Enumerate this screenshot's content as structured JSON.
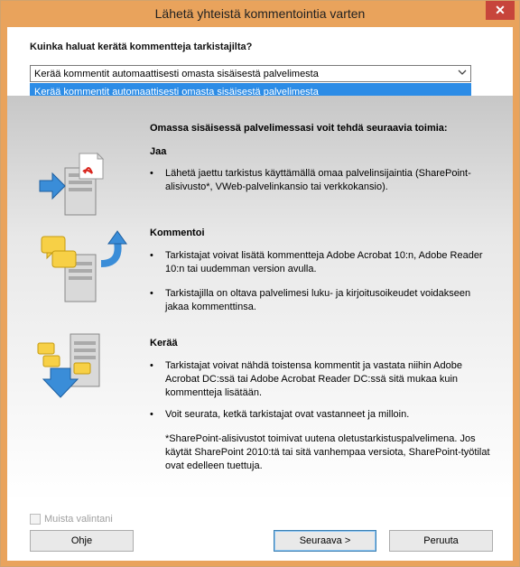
{
  "window": {
    "title": "Lähetä yhteistä kommentointia varten",
    "close_symbol": "✕"
  },
  "top": {
    "question": "Kuinka haluat kerätä kommentteja tarkistajilta?",
    "select_value": "Kerää kommentit automaattisesti omasta sisäisestä palvelimesta",
    "dropdown_options": [
      "Kerää kommentit automaattisesti omasta sisäisestä palvelimesta"
    ]
  },
  "main": {
    "intro": "Omassa sisäisessä palvelimessasi voit tehdä seuraavia toimia:",
    "sections": [
      {
        "title": "Jaa",
        "icon": "share-server-icon",
        "bullets": [
          "Lähetä jaettu tarkistus käyttämällä omaa palvelinsijaintia (SharePoint-alisivusto*, VWeb-palvelinkansio tai verkkokansio)."
        ]
      },
      {
        "title": "Kommentoi",
        "icon": "comment-server-icon",
        "bullets": [
          "Tarkistajat voivat lisätä kommentteja Adobe Acrobat 10:n, Adobe Reader 10:n tai uudemman version avulla.",
          "Tarkistajilla on oltava palvelimesi luku- ja kirjoitusoikeudet voidakseen jakaa kommenttinsa."
        ]
      },
      {
        "title": "Kerää",
        "icon": "collect-server-icon",
        "bullets": [
          "Tarkistajat voivat nähdä toistensa kommentit ja vastata niihin Adobe Acrobat DC:ssä tai Adobe Acrobat Reader DC:ssä sitä mukaa kuin kommentteja lisätään.",
          "Voit seurata, ketkä tarkistajat ovat vastanneet ja milloin."
        ],
        "note": "*SharePoint-alisivustot toimivat uutena oletustarkistuspalvelimena. Jos käytät SharePoint 2010:tä tai sitä vanhempaa versiota, SharePoint-työtilat ovat edelleen tuettuja."
      }
    ]
  },
  "footer": {
    "remember_label": "Muista valintani",
    "remember_checked": false,
    "help_label": "Ohje",
    "next_label": "Seuraava >",
    "cancel_label": "Peruuta"
  }
}
